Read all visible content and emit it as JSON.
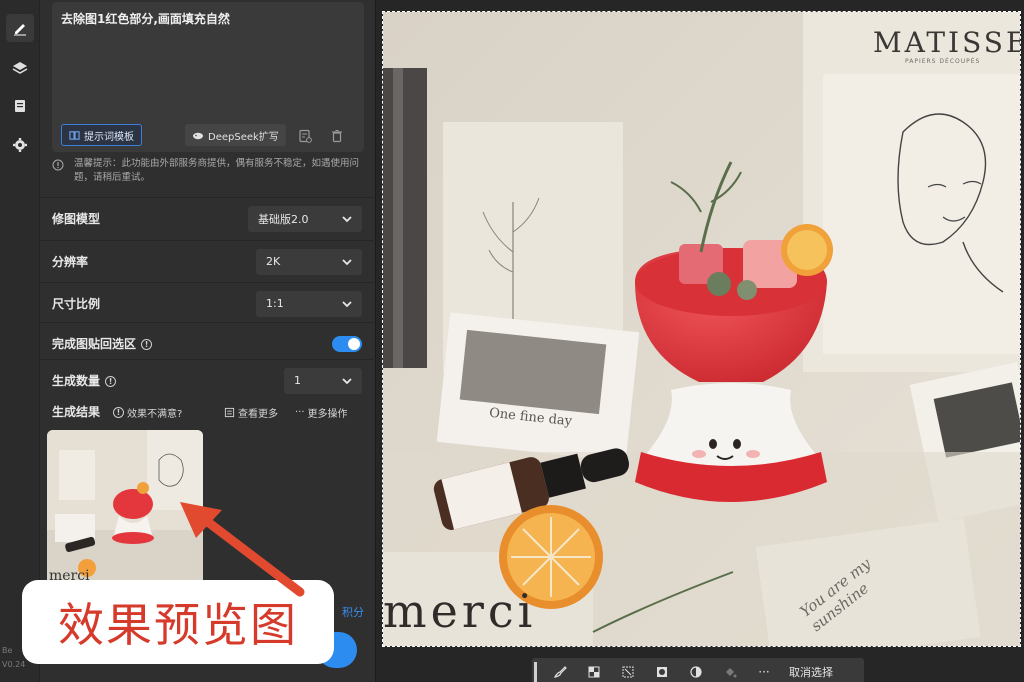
{
  "rail": {
    "version_top": "Be",
    "version_bottom": "V0.24"
  },
  "prompt": {
    "text": "去除图1红色部分,画面填充自然",
    "template_label": "提示词模板",
    "deepseek_label": "DeepSeek扩写"
  },
  "tip": {
    "text": "温馨提示：此功能由外部服务商提供，偶有服务不稳定，如遇使用问题，请稍后重试。"
  },
  "settings": {
    "model": {
      "label": "修图模型",
      "value": "基础版2.0"
    },
    "resolution": {
      "label": "分辨率",
      "value": "2K"
    },
    "ratio": {
      "label": "尺寸比例",
      "value": "1:1"
    },
    "paste_back": {
      "label": "完成图贴回选区",
      "enabled": true
    },
    "count": {
      "label": "生成数量",
      "value": "1"
    }
  },
  "results": {
    "label": "生成结果",
    "feedback": "效果不满意?",
    "view_more": "查看更多",
    "more_actions": "更多操作"
  },
  "overlay": {
    "text": "效果预览图",
    "side_text": "积分"
  },
  "canvas_toolbar": {
    "cancel_selection": "取消选择"
  },
  "photo": {
    "poster_title": "MATISSE",
    "poster_subtitle": "PAPIERS DÉCOUPÉS",
    "card_text": "One fine day",
    "merci": "merci",
    "note": "You are my sunshine"
  },
  "colors": {
    "accent": "#2d8cf0",
    "overlay_text": "#d63a2a"
  }
}
